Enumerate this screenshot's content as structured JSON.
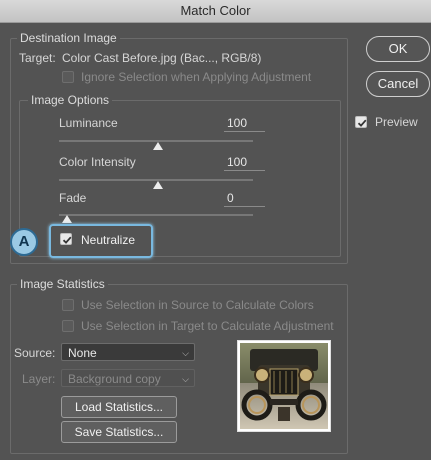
{
  "window": {
    "title": "Match Color"
  },
  "destination": {
    "title": "Destination Image",
    "target_label": "Target:",
    "target_value": "Color Cast Before.jpg (Bac..., RGB/8)",
    "ignore_selection_label": "Ignore Selection when Applying Adjustment"
  },
  "options": {
    "title": "Image Options",
    "luminance": {
      "label": "Luminance",
      "value": "100",
      "level_fraction": 0.5
    },
    "color_intensity": {
      "label": "Color Intensity",
      "value": "100",
      "level_fraction": 0.5
    },
    "fade": {
      "label": "Fade",
      "value": "0",
      "level_fraction": 0.0
    },
    "neutralize": {
      "label": "Neutralize",
      "checked": true
    }
  },
  "callout": {
    "label": "A"
  },
  "buttons": {
    "ok": "OK",
    "cancel": "Cancel"
  },
  "preview": {
    "label": "Preview",
    "checked": true
  },
  "statistics": {
    "title": "Image Statistics",
    "use_source_label": "Use Selection in Source to Calculate Colors",
    "use_target_label": "Use Selection in Target to Calculate Adjustment",
    "source_label": "Source:",
    "source_value": "None",
    "layer_label": "Layer:",
    "layer_value": "Background copy",
    "load_button": "Load Statistics...",
    "save_button": "Save Statistics..."
  },
  "colors": {
    "accent": "#79b9e0",
    "panel": "#535353",
    "titlebar": "#c9c9c9"
  }
}
